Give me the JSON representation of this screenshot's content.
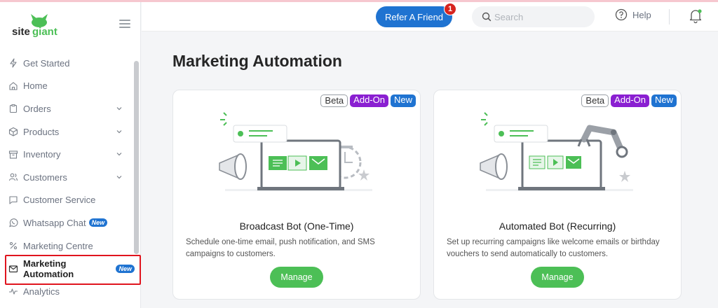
{
  "brand": {
    "logo_text": "sitegiant"
  },
  "header": {
    "refer_label": "Refer A Friend",
    "refer_count": "1",
    "search_placeholder": "Search",
    "search_value": "",
    "help_label": "Help"
  },
  "sidebar": {
    "items": [
      {
        "label": "Get Started",
        "icon": "lightning-icon"
      },
      {
        "label": "Home",
        "icon": "home-icon"
      },
      {
        "label": "Orders",
        "icon": "clipboard-icon"
      },
      {
        "label": "Products",
        "icon": "box-icon"
      },
      {
        "label": "Inventory",
        "icon": "archive-icon"
      },
      {
        "label": "Customers",
        "icon": "users-icon"
      },
      {
        "label": "Customer Service",
        "icon": "chat-icon"
      },
      {
        "label": "Whatsapp Chat",
        "icon": "whatsapp-icon",
        "badge": "New"
      },
      {
        "label": "Marketing Centre",
        "icon": "percent-icon"
      },
      {
        "label": "Marketing Automation",
        "icon": "mail-icon",
        "badge": "New"
      },
      {
        "label": "Analytics",
        "icon": "pulse-icon"
      }
    ]
  },
  "main": {
    "title": "Marketing Automation",
    "cards": [
      {
        "tags": [
          "Beta",
          "Add-On",
          "New"
        ],
        "title": "Broadcast Bot (One-Time)",
        "description": "Schedule one-time email, push notification, and SMS campaigns to customers.",
        "button": "Manage"
      },
      {
        "tags": [
          "Beta",
          "Add-On",
          "New"
        ],
        "title": "Automated Bot (Recurring)",
        "description": "Set up recurring campaigns like welcome emails or birthday vouchers to send automatically to customers.",
        "button": "Manage"
      }
    ]
  },
  "colors": {
    "primary": "#1f73d1",
    "accent_green": "#4cbf56",
    "addon_purple": "#8a1fd1",
    "highlight_red": "#e0141e"
  }
}
